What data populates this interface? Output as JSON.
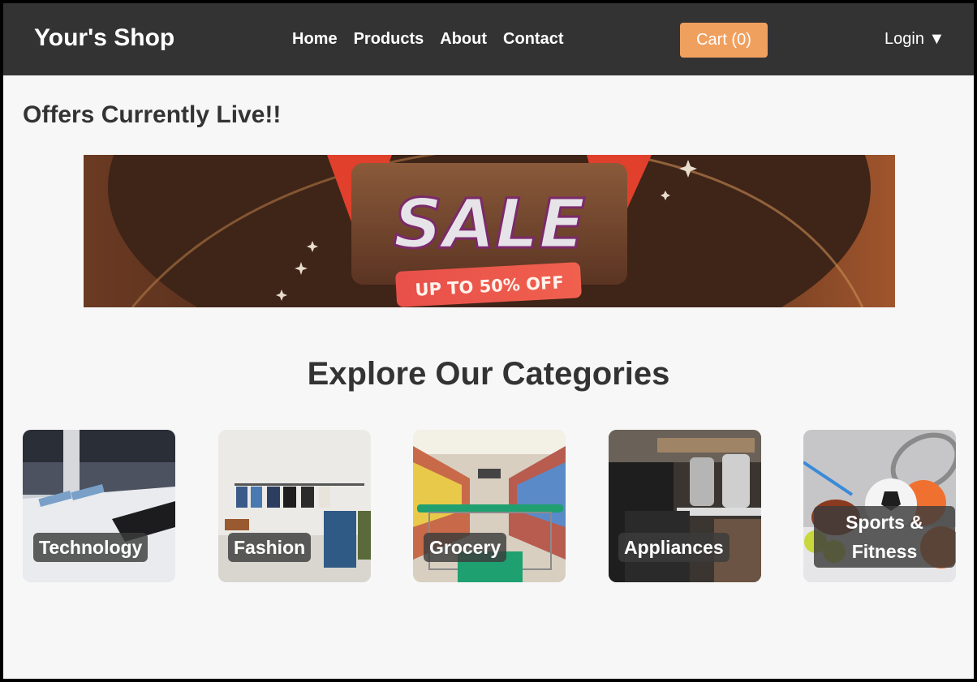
{
  "header": {
    "brand": "Your's Shop",
    "nav": [
      "Home",
      "Products",
      "About",
      "Contact"
    ],
    "cart_label": "Cart (0)",
    "login_label": "Login ▼"
  },
  "offers": {
    "title": "Offers Currently Live!!",
    "banner": {
      "headline": "SALE",
      "subline": "UP TO 50% OFF"
    }
  },
  "categories": {
    "title": "Explore Our Categories",
    "items": [
      {
        "label": "Technology"
      },
      {
        "label": "Fashion"
      },
      {
        "label": "Grocery"
      },
      {
        "label": "Appliances"
      },
      {
        "label": "Sports & Fitness"
      }
    ]
  },
  "colors": {
    "header_bg": "#333333",
    "cart_button": "#f0a05e",
    "page_bg": "#f7f7f7"
  }
}
